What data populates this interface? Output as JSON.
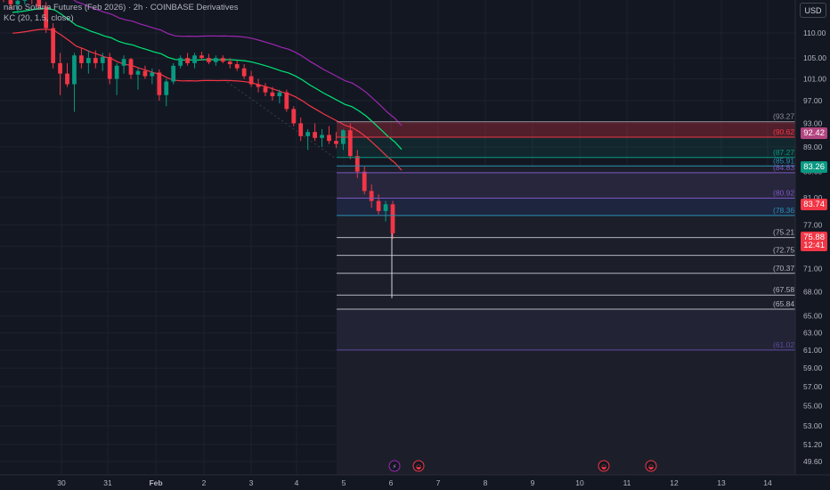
{
  "header": {
    "title": "nano Solana Futures (Feb 2026) · 2h · COINBASE Derivatives",
    "indicator": "KC (20, 1.5, close)",
    "currency_button": "USD"
  },
  "colors": {
    "background": "#131722",
    "bull": "#089981",
    "bear": "#f23645",
    "kc_upper": "#9c27b0",
    "kc_middle": "#00e676",
    "kc_lower": "#f23645",
    "axis_text": "#b2b5be"
  },
  "chart_data": {
    "type": "candlestick",
    "title": "nano Solana Futures (Feb 2026) · 2h · COINBASE Derivatives",
    "price_axis": {
      "ticks": [
        "110.00",
        "105.00",
        "101.00",
        "97.00",
        "93.00",
        "89.00",
        "85.00",
        "81.00",
        "77.00",
        "74.00",
        "71.00",
        "68.00",
        "65.00",
        "63.00",
        "61.00",
        "59.00",
        "57.00",
        "55.00",
        "53.00",
        "51.20",
        "49.60"
      ],
      "scale": "log",
      "range": [
        48.9,
        118
      ]
    },
    "time_axis": {
      "ticks": [
        "30",
        "31",
        "Feb",
        "2",
        "3",
        "4",
        "5",
        "6",
        "7",
        "8",
        "9",
        "10",
        "11",
        "12",
        "13",
        "14"
      ]
    },
    "price_badges": [
      {
        "label": "92.42",
        "color": "#b2457f"
      },
      {
        "label": "83.26",
        "color": "#089981"
      },
      {
        "label": "83.74",
        "color": "#f23645"
      },
      {
        "label": "75.88",
        "color": "#f23645"
      },
      {
        "label": "12:41",
        "color": "#f23645"
      }
    ],
    "levels": [
      {
        "label": "(93.27)",
        "value": 93.27,
        "color": "#8b8d96"
      },
      {
        "label": "(90.62)",
        "value": 90.62,
        "color": "#f23645"
      },
      {
        "label": "(87.27)",
        "value": 87.27,
        "color": "#089981"
      },
      {
        "label": "(85.91)",
        "value": 85.91,
        "color": "#2a8fb0"
      },
      {
        "label": "(84.83)",
        "value": 84.83,
        "color": "#7e57c2"
      },
      {
        "label": "(80.92)",
        "value": 80.92,
        "color": "#7e57c2"
      },
      {
        "label": "(78.36)",
        "value": 78.36,
        "color": "#2a8fb0"
      },
      {
        "label": "(75.21)",
        "value": 75.21,
        "color": "#b2b5be"
      },
      {
        "label": "(72.75)",
        "value": 72.75,
        "color": "#b2b5be"
      },
      {
        "label": "(70.37)",
        "value": 70.37,
        "color": "#b2b5be"
      },
      {
        "label": "(67.58)",
        "value": 67.58,
        "color": "#b2b5be"
      },
      {
        "label": "(65.84)",
        "value": 65.84,
        "color": "#b2b5be"
      },
      {
        "label": "(61.02)",
        "value": 61.02,
        "color": "#5c4b9f"
      }
    ],
    "candles_ohlc": [
      [
        118,
        118.5,
        116.5,
        117.2
      ],
      [
        117.2,
        118,
        115,
        116
      ],
      [
        116,
        117.5,
        114,
        116.8
      ],
      [
        116.8,
        118,
        116,
        117.5
      ],
      [
        117.5,
        118,
        116,
        117
      ],
      [
        117,
        117.8,
        115,
        115.5
      ],
      [
        115.5,
        116.5,
        110,
        111
      ],
      [
        111,
        112,
        103,
        104
      ],
      [
        104,
        106,
        98,
        102
      ],
      [
        102,
        104,
        99.5,
        100
      ],
      [
        100,
        106,
        95,
        105.5
      ],
      [
        105.5,
        107,
        103,
        104
      ],
      [
        104,
        106.5,
        102,
        105
      ],
      [
        105,
        106.5,
        103,
        104
      ],
      [
        104,
        106,
        102.5,
        105.2
      ],
      [
        105.2,
        106,
        100,
        101
      ],
      [
        101,
        104,
        98,
        103.5
      ],
      [
        103.5,
        105.5,
        102,
        104.8
      ],
      [
        104.8,
        105,
        101,
        101.8
      ],
      [
        101.8,
        103,
        99,
        102.5
      ],
      [
        102.5,
        103.5,
        101,
        101.5
      ],
      [
        101.5,
        103,
        100,
        102.2
      ],
      [
        102.2,
        102.8,
        97,
        98
      ],
      [
        98,
        101,
        96,
        100.5
      ],
      [
        100.5,
        104,
        100,
        103.5
      ],
      [
        103.5,
        105.5,
        103,
        105
      ],
      [
        105,
        106,
        103.5,
        104
      ],
      [
        104,
        106,
        103,
        105.5
      ],
      [
        105.5,
        106.2,
        104.5,
        105
      ],
      [
        105,
        105.8,
        103.8,
        104.2
      ],
      [
        104.2,
        105.5,
        103.5,
        105
      ],
      [
        105,
        105.5,
        104,
        104.3
      ],
      [
        104.3,
        105,
        103,
        103.8
      ],
      [
        103.8,
        104.5,
        102.5,
        103
      ],
      [
        103,
        103.8,
        101,
        101.5
      ],
      [
        101.5,
        102.5,
        99.5,
        100
      ],
      [
        100,
        101,
        98.5,
        99.5
      ],
      [
        99.5,
        100.2,
        97.8,
        98.5
      ],
      [
        98.5,
        99.5,
        97,
        97.8
      ],
      [
        97.8,
        99,
        96.5,
        98.5
      ],
      [
        98.5,
        99,
        95,
        95.5
      ],
      [
        95.5,
        96,
        92.5,
        93
      ],
      [
        93,
        94,
        90,
        90.8
      ],
      [
        90.8,
        92,
        88.5,
        91.5
      ],
      [
        91.5,
        93,
        90,
        90.5
      ],
      [
        90.5,
        92,
        89,
        91
      ],
      [
        91,
        92.5,
        89.5,
        90
      ],
      [
        90,
        91.5,
        88.8,
        89.5
      ],
      [
        89.5,
        92,
        88.5,
        91.8
      ],
      [
        91.8,
        93,
        87,
        87.5
      ],
      [
        87.5,
        88.5,
        84,
        85
      ],
      [
        85,
        85.8,
        81.5,
        82
      ],
      [
        82,
        83,
        79.5,
        80.5
      ],
      [
        80.5,
        81.5,
        78.5,
        79
      ],
      [
        79,
        80.5,
        77.5,
        80
      ],
      [
        80,
        80.5,
        75,
        75.8
      ]
    ],
    "keltner": {
      "upper_start": 117,
      "middle_start": 114,
      "lower_start": 108
    },
    "event_icons": [
      "lightning-icon",
      "earnings-icon",
      "earnings-icon",
      "earnings-icon"
    ]
  }
}
